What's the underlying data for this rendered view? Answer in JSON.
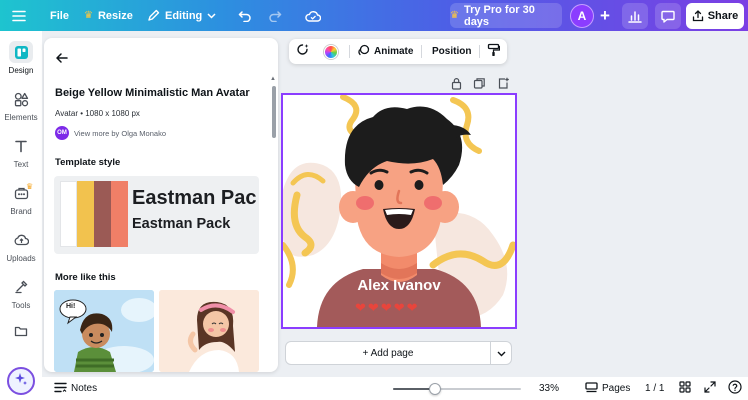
{
  "topbar": {
    "file_label": "File",
    "resize_label": "Resize",
    "editing_label": "Editing",
    "try_pro_label": "Try Pro for 30 days",
    "avatar_initial": "A",
    "share_label": "Share",
    "gradient_colors": [
      "#1ec4cf",
      "#4d5fe6",
      "#7b3fe4"
    ]
  },
  "rail": {
    "items": [
      {
        "label": "Design",
        "icon": "design-icon"
      },
      {
        "label": "Elements",
        "icon": "elements-icon"
      },
      {
        "label": "Text",
        "icon": "text-icon"
      },
      {
        "label": "Brand",
        "icon": "brand-icon"
      },
      {
        "label": "Uploads",
        "icon": "uploads-icon"
      },
      {
        "label": "Tools",
        "icon": "tools-icon"
      }
    ]
  },
  "panel": {
    "title": "Beige Yellow Minimalistic Man Avatar",
    "meta": "Avatar • 1080 x 1080 px",
    "author_initials": "OM",
    "author_link": "View more by Olga Monako",
    "template_style_heading": "Template style",
    "font_preview_big": "Eastman Pac",
    "font_preview_small": "Eastman Pack",
    "swatches": [
      "#ffffff",
      "#f2c24e",
      "#9b5a55",
      "#f07f67"
    ],
    "more_like_heading": "More like this",
    "thumb1_bubble": "Hi!"
  },
  "float_toolbar": {
    "animate_label": "Animate",
    "position_label": "Position"
  },
  "canvas": {
    "name_text": "Alex Ivanov",
    "hearts": [
      "❤",
      "❤",
      "❤",
      "❤",
      "❤"
    ],
    "accent": "#8b3dff"
  },
  "add_page_label": "+ Add page",
  "bottombar": {
    "notes_label": "Notes",
    "zoom_percent": 33,
    "zoom_label": "33%",
    "pages_label": "Pages",
    "page_count": "1 / 1"
  }
}
